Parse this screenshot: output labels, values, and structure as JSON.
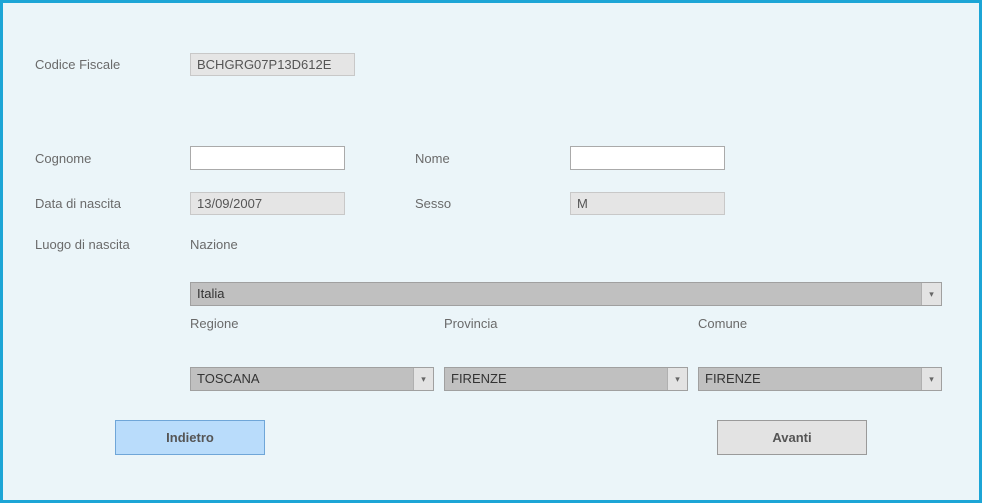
{
  "labels": {
    "codiceFiscale": "Codice Fiscale",
    "cognome": "Cognome",
    "nome": "Nome",
    "dataNascita": "Data di nascita",
    "sesso": "Sesso",
    "luogoNascita": "Luogo di nascita",
    "nazione": "Nazione",
    "regione": "Regione",
    "provincia": "Provincia",
    "comune": "Comune"
  },
  "values": {
    "codiceFiscale": "BCHGRG07P13D612E",
    "cognome": "",
    "nome": "",
    "dataNascita": "13/09/2007",
    "sesso": "M",
    "nazione": "Italia",
    "regione": "TOSCANA",
    "provincia": "FIRENZE",
    "comune": "FIRENZE"
  },
  "buttons": {
    "back": "Indietro",
    "next": "Avanti"
  }
}
